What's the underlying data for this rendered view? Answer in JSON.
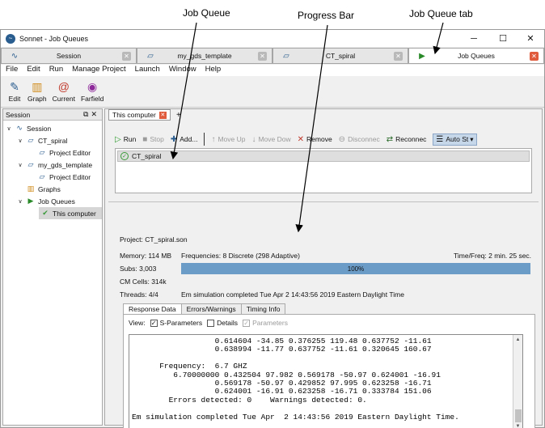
{
  "annotations": {
    "job_queue": "Job Queue",
    "progress_bar": "Progress Bar",
    "job_queue_tab": "Job Queue tab"
  },
  "window": {
    "title": "Sonnet - Job Queues",
    "controls": {
      "minimize": "─",
      "maximize": "☐",
      "close": "✕"
    }
  },
  "doc_tabs": [
    {
      "label": "Session",
      "icon": "session-icon"
    },
    {
      "label": "my_gds_template",
      "icon": "project-icon"
    },
    {
      "label": "CT_spiral",
      "icon": "project-icon"
    },
    {
      "label": "Job Queues",
      "icon": "job-queue-icon",
      "active": true
    }
  ],
  "menu": [
    "File",
    "Edit",
    "Run",
    "Manage Project",
    "Launch",
    "Window",
    "Help"
  ],
  "toolbar": [
    {
      "label": "Edit",
      "icon": "edit-icon"
    },
    {
      "label": "Graph",
      "icon": "graph-icon"
    },
    {
      "label": "Current",
      "icon": "current-icon"
    },
    {
      "label": "Farfield",
      "icon": "farfield-icon"
    }
  ],
  "session_panel": {
    "title": "Session",
    "tree": [
      {
        "label": "Session",
        "level": 0,
        "expanded": true,
        "icon": "session-icon"
      },
      {
        "label": "CT_spiral",
        "level": 1,
        "expanded": true,
        "icon": "project-icon"
      },
      {
        "label": "Project Editor",
        "level": 2,
        "icon": "editor-icon"
      },
      {
        "label": "my_gds_template",
        "level": 1,
        "expanded": true,
        "icon": "project-icon"
      },
      {
        "label": "Project Editor",
        "level": 2,
        "icon": "editor-icon"
      },
      {
        "label": "Graphs",
        "level": 1,
        "icon": "graphs-icon"
      },
      {
        "label": "Job Queues",
        "level": 1,
        "expanded": true,
        "icon": "job-queue-icon"
      },
      {
        "label": "This computer",
        "level": 2,
        "icon": "check-icon",
        "selected": true
      }
    ]
  },
  "queue_tab": {
    "label": "This computer",
    "add": "+"
  },
  "queue_toolbar": {
    "run": "Run",
    "stop": "Stop",
    "add": "Add...",
    "move_up": "Move Up",
    "move_down": "Move Dow",
    "remove": "Remove",
    "disconnect": "Disconnec",
    "reconnect": "Reconnec",
    "auto_start": "Auto St"
  },
  "queue_jobs": [
    {
      "name": "CT_spiral",
      "status": "complete"
    }
  ],
  "project": {
    "label": "Project:",
    "file": "CT_spiral.son",
    "memory": "Memory: 114 MB",
    "subs": "Subs: 3,003",
    "cm_cells": "CM Cells: 314k",
    "threads": "Threads: 4/4",
    "frequencies": "Frequencies:  8 Discrete (298 Adaptive)",
    "time_freq": "Time/Freq:  2 min. 25 sec.",
    "progress_percent": 100,
    "progress_text": "100%",
    "completed_msg": "Em simulation completed Tue Apr  2 14:43:56 2019 Eastern Daylight Time"
  },
  "result_tabs": [
    "Response Data",
    "Errors/Warnings",
    "Timing Info"
  ],
  "view_options": {
    "label": "View:",
    "s_parameters": {
      "label": "S-Parameters",
      "checked": true
    },
    "details": {
      "label": "Details",
      "checked": false
    },
    "parameters": {
      "label": "Parameters",
      "checked": true,
      "disabled": true
    }
  },
  "output_lines": [
    "                  0.614604 -34.85 0.376255 119.48 0.637752 -11.61",
    "                  0.638994 -11.77 0.637752 -11.61 0.320645 160.67",
    "",
    "      Frequency:  6.7 GHZ",
    "         6.70000000 0.432504 97.982 0.569178 -50.97 0.624001 -16.91",
    "                  0.569178 -50.97 0.429852 97.995 0.623258 -16.71",
    "                  0.624001 -16.91 0.623258 -16.71 0.333784 151.06",
    "        Errors detected: 0    Warnings detected: 0.",
    "",
    "Em simulation completed Tue Apr  2 14:43:56 2019 Eastern Daylight Time."
  ]
}
